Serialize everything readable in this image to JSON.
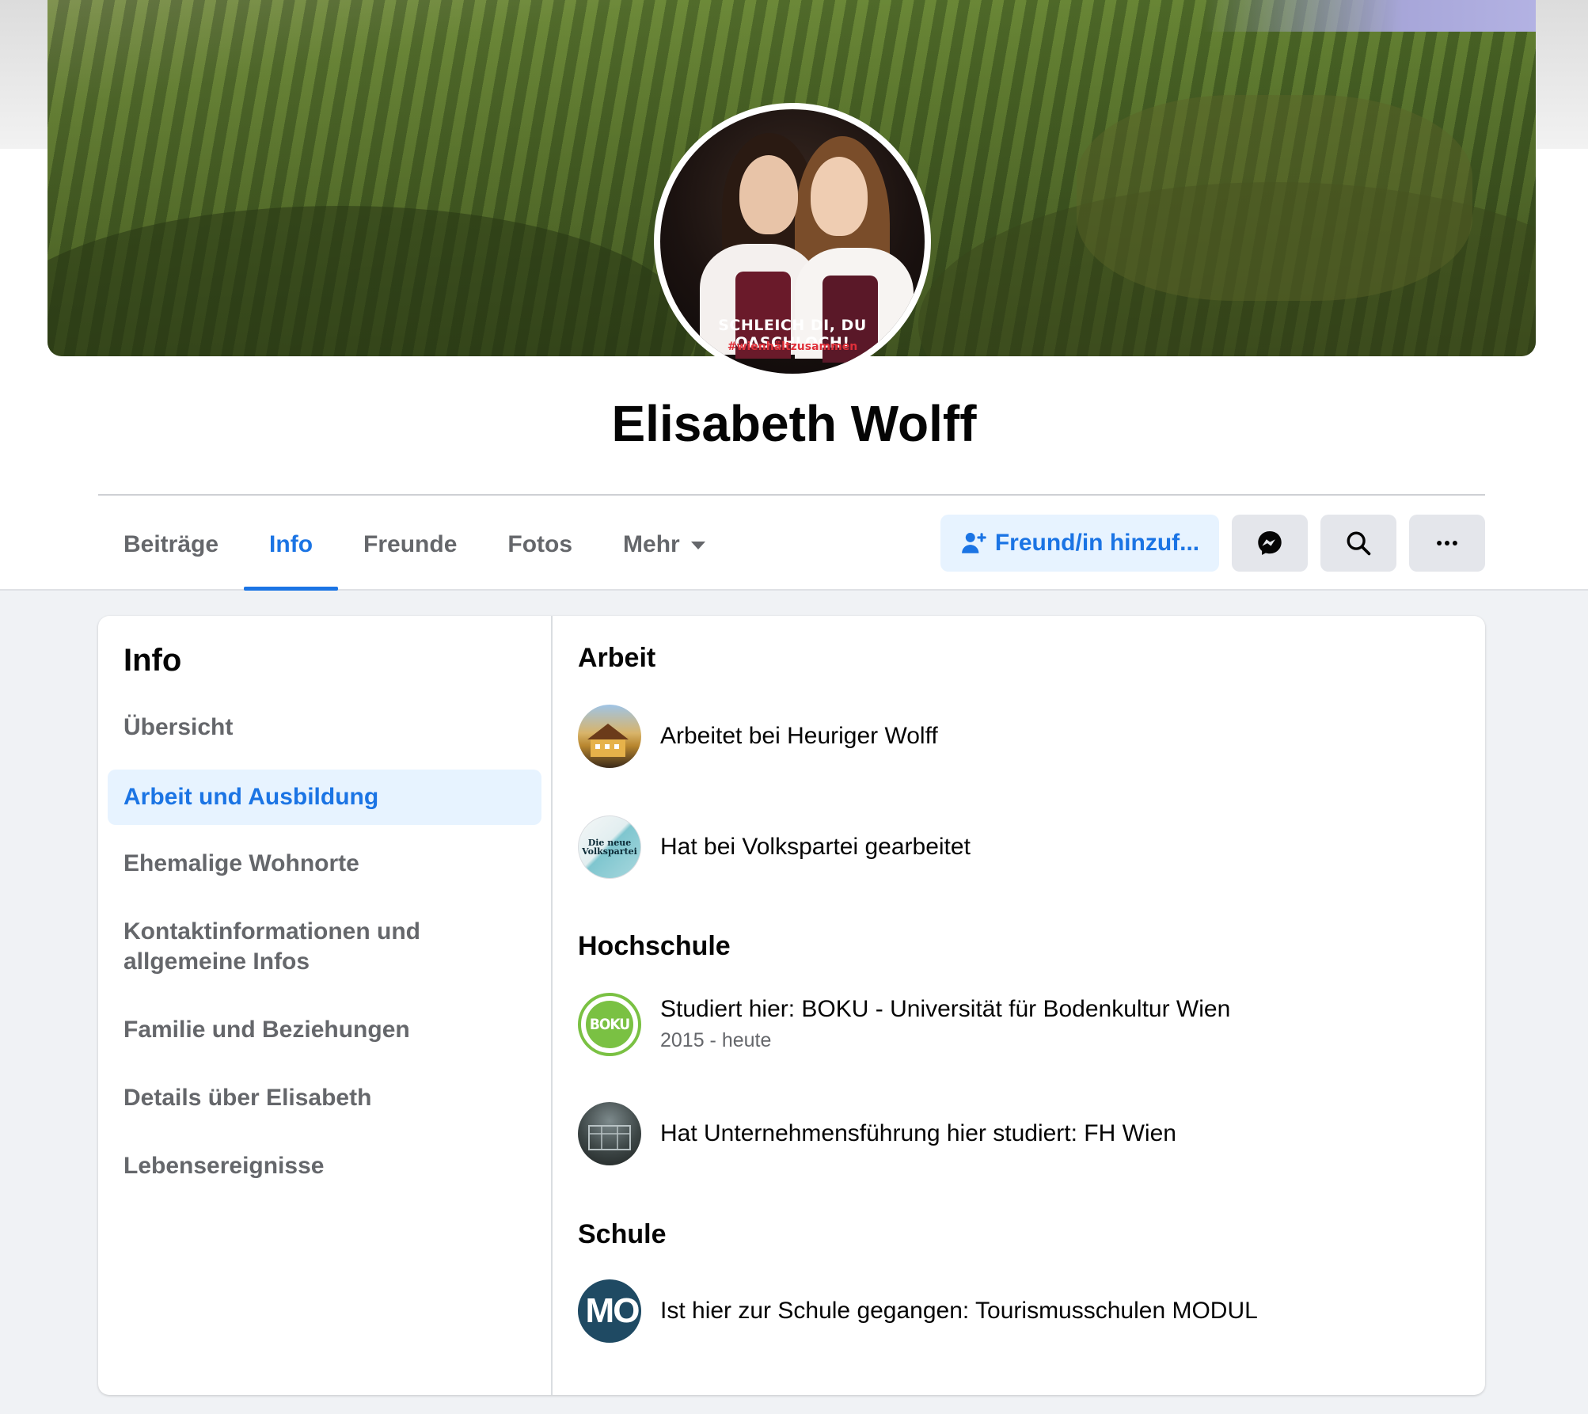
{
  "profile": {
    "name": "Elisabeth Wolff",
    "avatar_caption": "SCHLEICH DI, DU OASCHLOCH!",
    "avatar_hashtag": "#wienhältzusammen"
  },
  "tabs": [
    {
      "label": "Beiträge",
      "active": false
    },
    {
      "label": "Info",
      "active": true
    },
    {
      "label": "Freunde",
      "active": false
    },
    {
      "label": "Fotos",
      "active": false
    },
    {
      "label": "Mehr",
      "active": false
    }
  ],
  "actions": {
    "add_friend_label": "Freund/in hinzuf...",
    "messenger_icon": "messenger-icon",
    "search_icon": "search-icon",
    "more_icon": "more-icon"
  },
  "sidebar": {
    "title": "Info",
    "items": [
      {
        "label": "Übersicht",
        "active": false
      },
      {
        "label": "Arbeit und Ausbildung",
        "active": true
      },
      {
        "label": "Ehemalige Wohnorte",
        "active": false
      },
      {
        "label": "Kontaktinformationen und",
        "label2": "allgemeine Infos",
        "active": false
      },
      {
        "label": "Familie und Beziehungen",
        "active": false
      },
      {
        "label": "Details über Elisabeth",
        "active": false
      },
      {
        "label": "Lebensereignisse",
        "active": false
      }
    ]
  },
  "content": {
    "work_title": "Arbeit",
    "work": [
      {
        "text": "Arbeitet bei Heuriger Wolff"
      },
      {
        "text": "Hat bei Volkspartei gearbeitet",
        "logo_text_1": "Die neue",
        "logo_text_2": "Volkspartei"
      }
    ],
    "college_title": "Hochschule",
    "college": [
      {
        "text": "Studiert hier: BOKU - Universität für Bodenkultur Wien",
        "sub": "2015 - heute",
        "logo_text": "BOKU"
      },
      {
        "text": "Hat Unternehmensführung hier studiert: FH Wien"
      }
    ],
    "school_title": "Schule",
    "school": [
      {
        "text": "Ist hier zur Schule gegangen: Tourismusschulen MODUL",
        "logo_text": "MO"
      }
    ]
  },
  "colors": {
    "accent": "#1b74e4",
    "accent_bg": "#e7f3ff",
    "secondary_text": "#65676b",
    "page_bg": "#f0f2f5"
  }
}
